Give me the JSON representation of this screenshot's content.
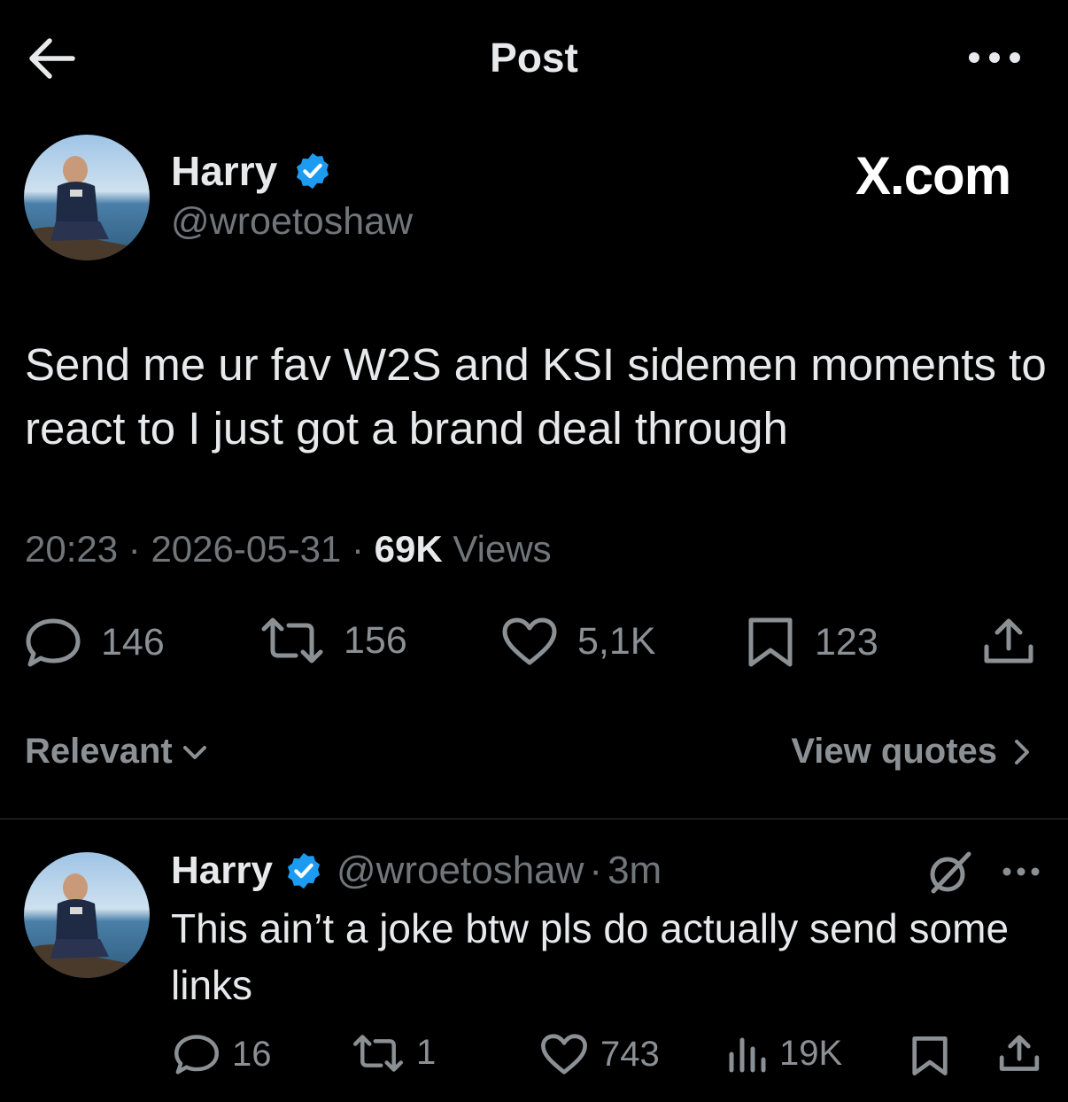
{
  "header": {
    "title": "Post",
    "back_icon": "arrow-left-icon",
    "more_icon": "more-horizontal-icon"
  },
  "colors": {
    "background": "#000000",
    "text": "#e7e9ea",
    "muted": "#71767b",
    "verified": "#1d9bf0",
    "divider": "#2f3336"
  },
  "post": {
    "author_name": "Harry",
    "author_handle": "@wroetoshaw",
    "watermark": "X.com",
    "text": "Send me ur fav W2S and KSI sidemen moments to react to I just got a brand deal through",
    "time": "20:23",
    "date": "2026-05-31",
    "sep": "·",
    "views_count": "69K",
    "views_label": "Views",
    "stats": {
      "replies": "146",
      "reposts": "156",
      "likes": "5,1K",
      "bookmarks": "123"
    }
  },
  "filters": {
    "sort_label": "Relevant",
    "quotes_label": "View quotes"
  },
  "reply": {
    "author_name": "Harry",
    "author_handle": "@wroetoshaw",
    "sep": "·",
    "time": "3m",
    "text": "This ain’t a joke btw pls do actually send some links",
    "stats": {
      "replies": "16",
      "reposts": "1",
      "likes": "743",
      "views": "19K"
    }
  }
}
